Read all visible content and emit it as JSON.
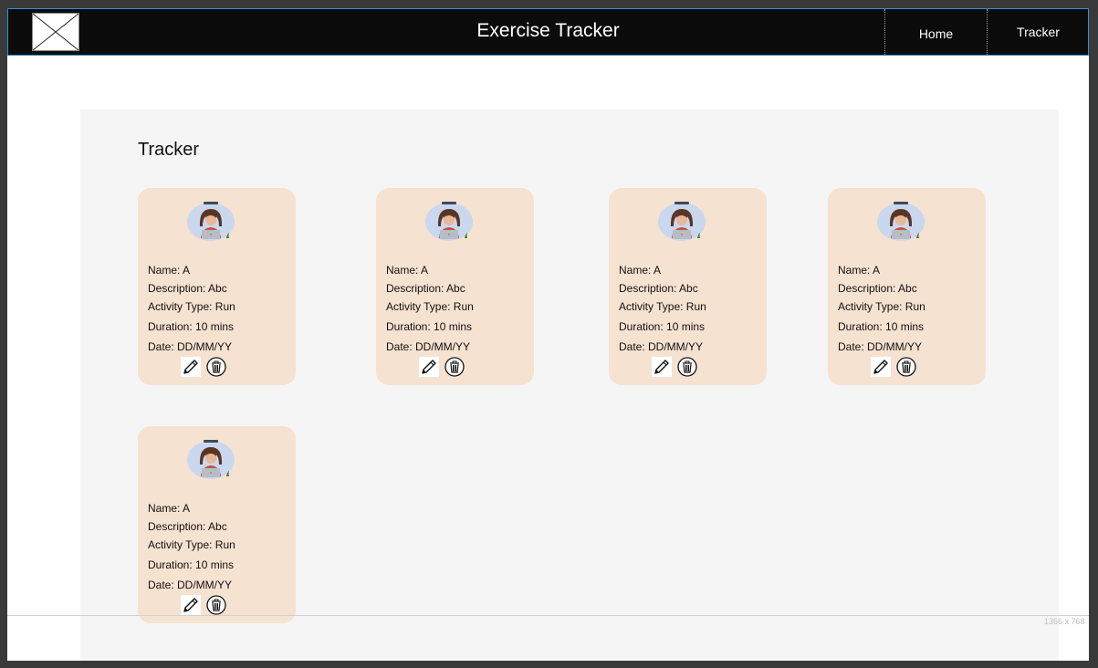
{
  "header": {
    "title": "Exercise Tracker",
    "nav": [
      "Home",
      "Tracker"
    ]
  },
  "page": {
    "section_title": "Tracker"
  },
  "cards": [
    {
      "name": "Name: A",
      "description": "Description: Abc",
      "activity": "Activity Type: Run",
      "duration": "Duration: 10 mins",
      "date": "Date: DD/MM/YY"
    },
    {
      "name": "Name: A",
      "description": "Description: Abc",
      "activity": "Activity Type: Run",
      "duration": "Duration: 10 mins",
      "date": "Date: DD/MM/YY"
    },
    {
      "name": "Name: A",
      "description": "Description: Abc",
      "activity": "Activity Type: Run",
      "duration": "Duration: 10 mins",
      "date": "Date: DD/MM/YY"
    },
    {
      "name": "Name: A",
      "description": "Description: Abc",
      "activity": "Activity Type: Run",
      "duration": "Duration: 10 mins",
      "date": "Date: DD/MM/YY"
    },
    {
      "name": "Name: A",
      "description": "Description: Abc",
      "activity": "Activity Type: Run",
      "duration": "Duration: 10 mins",
      "date": "Date: DD/MM/YY"
    }
  ],
  "icons": {
    "logo": "image-placeholder-icon",
    "avatar": "user-avatar-icon",
    "edit": "pencil-icon",
    "delete": "trash-icon"
  },
  "colors": {
    "navbar": "#0b0b0b",
    "navbar_border": "#3a8ed0",
    "card": "#f6e2d0",
    "content_bg": "#f5f5f5"
  },
  "viewport_label": "1366 x 768"
}
